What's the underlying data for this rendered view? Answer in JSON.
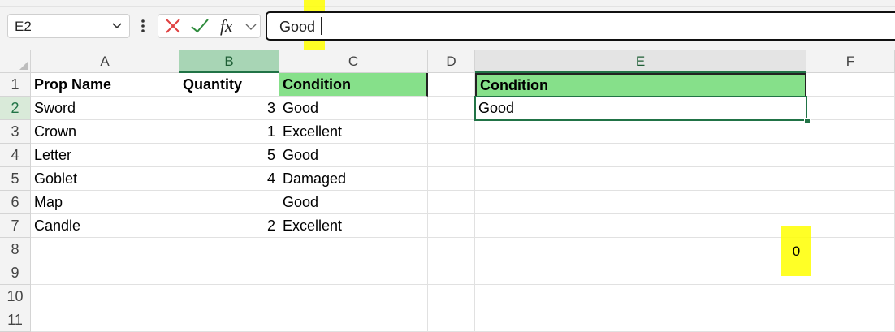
{
  "formula_bar": {
    "name_box": "E2",
    "cancel_icon": "close-icon",
    "enter_icon": "check-icon",
    "fx_label": "fx",
    "formula_value": "Good"
  },
  "columns": [
    "A",
    "B",
    "C",
    "D",
    "E",
    "F"
  ],
  "rows": [
    "1",
    "2",
    "3",
    "4",
    "5",
    "6",
    "7",
    "8",
    "9",
    "10",
    "11"
  ],
  "table": {
    "headers": {
      "prop_name": "Prop Name",
      "quantity": "Quantity",
      "condition": "Condition"
    },
    "data": [
      {
        "prop": "Sword",
        "qty": "3",
        "cond": "Good"
      },
      {
        "prop": "Crown",
        "qty": "1",
        "cond": "Excellent"
      },
      {
        "prop": "Letter",
        "qty": "5",
        "cond": "Good"
      },
      {
        "prop": "Goblet",
        "qty": "4",
        "cond": "Damaged"
      },
      {
        "prop": "Map",
        "qty": "",
        "cond": "Good"
      },
      {
        "prop": "Candle",
        "qty": "2",
        "cond": "Excellent"
      }
    ]
  },
  "criteria": {
    "header": "Condition",
    "value": "Good"
  },
  "result_value": "0",
  "colors": {
    "header_green": "#86e08a",
    "selection": "#217346",
    "highlight": "#ffff00"
  }
}
